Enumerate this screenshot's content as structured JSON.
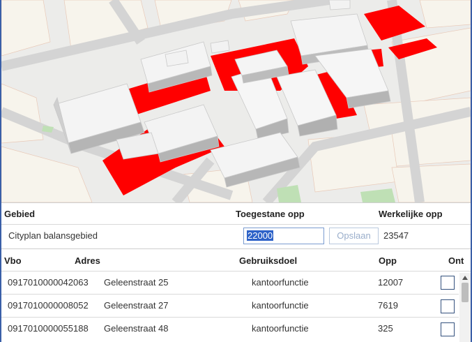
{
  "area_table": {
    "headers": {
      "gebied": "Gebied",
      "toegestane": "Toegestane opp",
      "werkelijke": "Werkelijke opp"
    },
    "row": {
      "gebied": "Cityplan balansgebied",
      "toegestane_value": "22000",
      "save_label": "Opslaan",
      "werkelijke": "23547"
    }
  },
  "vbo_table": {
    "headers": {
      "vbo": "Vbo",
      "adres": "Adres",
      "gebruiksdoel": "Gebruiksdoel",
      "opp": "Opp",
      "ont": "Ont"
    },
    "rows": [
      {
        "vbo": "0917010000042063",
        "adres": "Geleenstraat 25",
        "gebruiksdoel": "kantoorfunctie",
        "opp": "12007"
      },
      {
        "vbo": "0917010000008052",
        "adres": "Geleenstraat 27",
        "gebruiksdoel": "kantoorfunctie",
        "opp": "7619"
      },
      {
        "vbo": "0917010000055188",
        "adres": "Geleenstraat 48",
        "gebruiksdoel": "kantoorfunctie",
        "opp": "325"
      }
    ]
  },
  "colors": {
    "highlight": "#ff0000",
    "building": "#f2f2f2",
    "road": "#d6d6d6",
    "park": "#c8e6c0",
    "selection": "#2d62c8",
    "frame": "#3a5fa8"
  }
}
